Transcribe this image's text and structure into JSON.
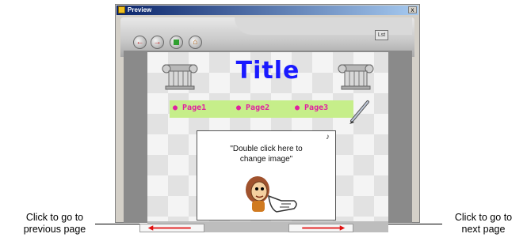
{
  "window": {
    "title": "Preview",
    "close_glyph": "x"
  },
  "toolbar": {
    "buttons": [
      {
        "name": "back-icon",
        "glyph": "←"
      },
      {
        "name": "forward-icon",
        "glyph": "→"
      },
      {
        "name": "stop-icon",
        "glyph": ""
      },
      {
        "name": "home-icon",
        "glyph": "⌂"
      }
    ],
    "close_preview_label": "Lst"
  },
  "page": {
    "title": "Title",
    "nav": [
      "● Page1",
      "● Page2",
      "● Page3"
    ],
    "card_line1": "\"Double click here to",
    "card_line2": "change image\""
  },
  "callouts": {
    "prev_line1": "Click to go to",
    "prev_line2": "previous page",
    "next_line1": "Click to go to",
    "next_line2": "next page"
  },
  "colors": {
    "title": "#1a1aff",
    "nav_bar": "#c6ee8a",
    "nav_text": "#e020a0",
    "arrows": "#e01010"
  }
}
